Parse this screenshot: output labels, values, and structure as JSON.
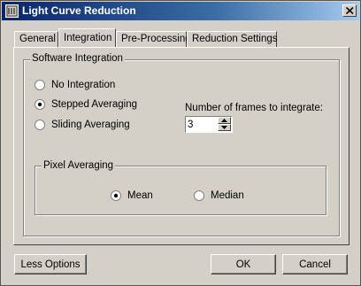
{
  "window": {
    "title": "Light Curve Reduction"
  },
  "tabs": [
    {
      "label": "General"
    },
    {
      "label": "Integration"
    },
    {
      "label": "Pre-Processing"
    },
    {
      "label": "Reduction Settings"
    }
  ],
  "software_integration": {
    "group_label": "Software Integration",
    "options": [
      {
        "label": "No Integration",
        "checked": false
      },
      {
        "label": "Stepped Averaging",
        "checked": true
      },
      {
        "label": "Sliding Averaging",
        "checked": false
      }
    ],
    "frames_label": "Number of frames to integrate:",
    "frames_value": "3"
  },
  "pixel_averaging": {
    "group_label": "Pixel Averaging",
    "options": [
      {
        "label": "Mean",
        "checked": true
      },
      {
        "label": "Median",
        "checked": false
      }
    ]
  },
  "buttons": {
    "less_options": "Less Options",
    "ok": "OK",
    "cancel": "Cancel"
  }
}
